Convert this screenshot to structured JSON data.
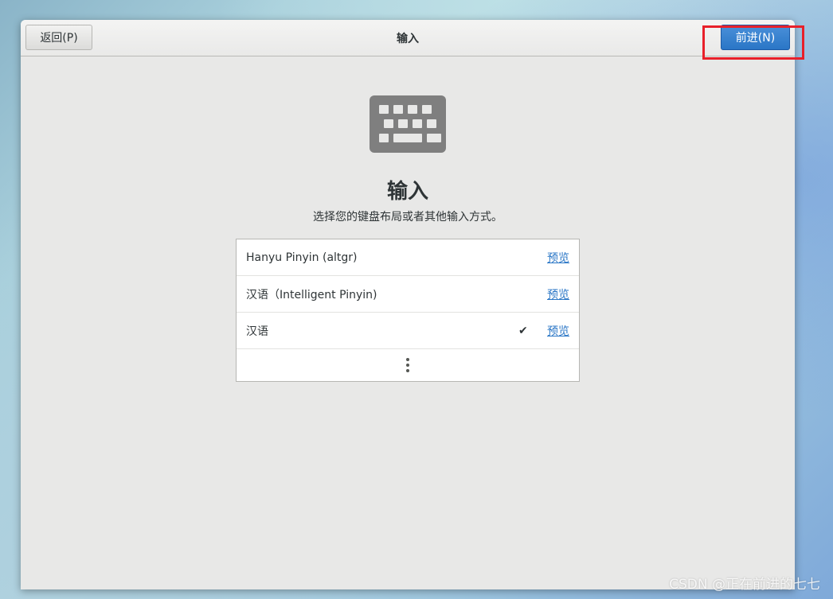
{
  "header": {
    "back_label": "返回(P)",
    "title": "输入",
    "next_label": "前进(N)"
  },
  "main": {
    "icon": "keyboard-icon",
    "title": "输入",
    "subtitle": "选择您的键盘布局或者其他输入方式。"
  },
  "input_sources": [
    {
      "label": "Hanyu Pinyin (altgr)",
      "selected": false,
      "preview_label": "预览"
    },
    {
      "label": "汉语（Intelligent Pinyin)",
      "selected": false,
      "preview_label": "预览"
    },
    {
      "label": "汉语",
      "selected": true,
      "check": "✔",
      "preview_label": "预览"
    }
  ],
  "more_icon": "vertical-ellipsis-icon",
  "annotation": {
    "highlight_color": "#e8202a"
  },
  "watermark": "CSDN @正在前进的七七",
  "colors": {
    "accent": "#2a76c6",
    "window_bg": "#e8e8e7"
  }
}
